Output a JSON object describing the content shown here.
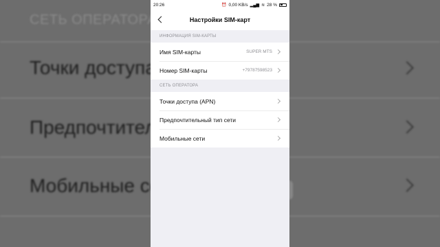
{
  "background": {
    "section_header": "СЕТЬ ОПЕРАТОРА",
    "rows": [
      "Точки доступа (APN)",
      "Предпочтительный тип сети",
      "Мобильные сети"
    ]
  },
  "status_bar": {
    "time": "20:26",
    "net_speed": "0,00 KB/s",
    "battery_percent": "28 %"
  },
  "title_bar": {
    "title": "Настройки SIM-карт"
  },
  "sim_info": {
    "header": "ИНФОРМАЦИЯ SIM-КАРТЫ",
    "rows": [
      {
        "label": "Имя SIM-карты",
        "value": "SUPER MTS"
      },
      {
        "label": "Номер SIM-карты",
        "value": "+79787598523"
      }
    ]
  },
  "operator_network": {
    "header": "СЕТЬ ОПЕРАТОРА",
    "rows": [
      {
        "label": "Точки доступа (APN)"
      },
      {
        "label": "Предпочтительный тип сети"
      },
      {
        "label": "Мобильные сети"
      }
    ]
  },
  "colors": {
    "page_bg": "#efeff4",
    "card_bg": "#ffffff",
    "secondary_text": "#8e8e93"
  }
}
